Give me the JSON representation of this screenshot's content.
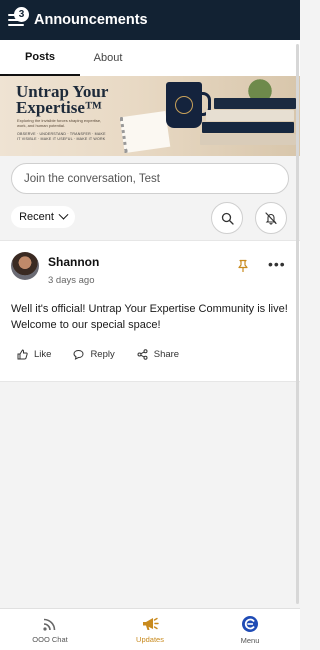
{
  "header": {
    "title": "Announcements",
    "badge_count": "3"
  },
  "tabs": [
    {
      "label": "Posts",
      "active": true
    },
    {
      "label": "About",
      "active": false
    }
  ],
  "banner": {
    "title_line1": "Untrap Your",
    "title_line2": "Expertise™",
    "subtitle": "Exploring the invisible forces shaping expertise, work, and human potential.",
    "words": "OBSERVE · UNDERSTAND · TRANSFER · MAKE IT VISIBLE · MAKE IT USEFUL · MAKE IT WORK"
  },
  "composer": {
    "placeholder": "Join the conversation, Test"
  },
  "sort": {
    "label": "Recent"
  },
  "post": {
    "author": "Shannon",
    "time": "3 days ago",
    "body": "Well it's official! Untrap Your Expertise Community is live! Welcome to our special space!",
    "like_label": "Like",
    "reply_label": "Reply",
    "share_label": "Share"
  },
  "bottom_nav": [
    {
      "label": "OOO Chat",
      "icon": "rss-icon"
    },
    {
      "label": "Updates",
      "icon": "megaphone-icon",
      "active": true
    },
    {
      "label": "Menu",
      "icon": "menu-logo-icon"
    }
  ],
  "colors": {
    "header_bg": "#122233",
    "accent": "#c88a1e",
    "menu_blue": "#1f4bb5"
  }
}
